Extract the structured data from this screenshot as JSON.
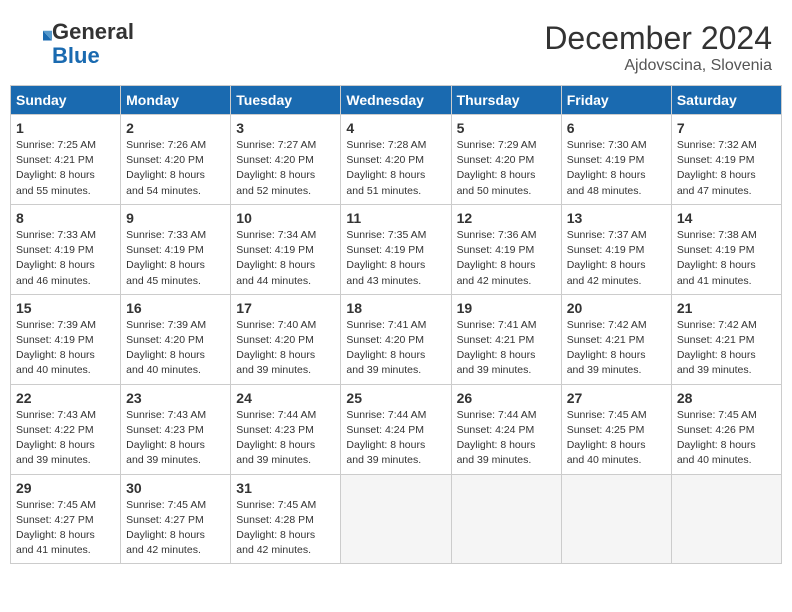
{
  "header": {
    "logo_line1": "General",
    "logo_line2": "Blue",
    "title": "December 2024",
    "subtitle": "Ajdovscina, Slovenia"
  },
  "calendar": {
    "days_of_week": [
      "Sunday",
      "Monday",
      "Tuesday",
      "Wednesday",
      "Thursday",
      "Friday",
      "Saturday"
    ],
    "weeks": [
      [
        {
          "day": "1",
          "sunrise": "7:25 AM",
          "sunset": "4:21 PM",
          "daylight": "8 hours and 55 minutes."
        },
        {
          "day": "2",
          "sunrise": "7:26 AM",
          "sunset": "4:20 PM",
          "daylight": "8 hours and 54 minutes."
        },
        {
          "day": "3",
          "sunrise": "7:27 AM",
          "sunset": "4:20 PM",
          "daylight": "8 hours and 52 minutes."
        },
        {
          "day": "4",
          "sunrise": "7:28 AM",
          "sunset": "4:20 PM",
          "daylight": "8 hours and 51 minutes."
        },
        {
          "day": "5",
          "sunrise": "7:29 AM",
          "sunset": "4:20 PM",
          "daylight": "8 hours and 50 minutes."
        },
        {
          "day": "6",
          "sunrise": "7:30 AM",
          "sunset": "4:19 PM",
          "daylight": "8 hours and 48 minutes."
        },
        {
          "day": "7",
          "sunrise": "7:32 AM",
          "sunset": "4:19 PM",
          "daylight": "8 hours and 47 minutes."
        }
      ],
      [
        {
          "day": "8",
          "sunrise": "7:33 AM",
          "sunset": "4:19 PM",
          "daylight": "8 hours and 46 minutes."
        },
        {
          "day": "9",
          "sunrise": "7:33 AM",
          "sunset": "4:19 PM",
          "daylight": "8 hours and 45 minutes."
        },
        {
          "day": "10",
          "sunrise": "7:34 AM",
          "sunset": "4:19 PM",
          "daylight": "8 hours and 44 minutes."
        },
        {
          "day": "11",
          "sunrise": "7:35 AM",
          "sunset": "4:19 PM",
          "daylight": "8 hours and 43 minutes."
        },
        {
          "day": "12",
          "sunrise": "7:36 AM",
          "sunset": "4:19 PM",
          "daylight": "8 hours and 42 minutes."
        },
        {
          "day": "13",
          "sunrise": "7:37 AM",
          "sunset": "4:19 PM",
          "daylight": "8 hours and 42 minutes."
        },
        {
          "day": "14",
          "sunrise": "7:38 AM",
          "sunset": "4:19 PM",
          "daylight": "8 hours and 41 minutes."
        }
      ],
      [
        {
          "day": "15",
          "sunrise": "7:39 AM",
          "sunset": "4:19 PM",
          "daylight": "8 hours and 40 minutes."
        },
        {
          "day": "16",
          "sunrise": "7:39 AM",
          "sunset": "4:20 PM",
          "daylight": "8 hours and 40 minutes."
        },
        {
          "day": "17",
          "sunrise": "7:40 AM",
          "sunset": "4:20 PM",
          "daylight": "8 hours and 39 minutes."
        },
        {
          "day": "18",
          "sunrise": "7:41 AM",
          "sunset": "4:20 PM",
          "daylight": "8 hours and 39 minutes."
        },
        {
          "day": "19",
          "sunrise": "7:41 AM",
          "sunset": "4:21 PM",
          "daylight": "8 hours and 39 minutes."
        },
        {
          "day": "20",
          "sunrise": "7:42 AM",
          "sunset": "4:21 PM",
          "daylight": "8 hours and 39 minutes."
        },
        {
          "day": "21",
          "sunrise": "7:42 AM",
          "sunset": "4:21 PM",
          "daylight": "8 hours and 39 minutes."
        }
      ],
      [
        {
          "day": "22",
          "sunrise": "7:43 AM",
          "sunset": "4:22 PM",
          "daylight": "8 hours and 39 minutes."
        },
        {
          "day": "23",
          "sunrise": "7:43 AM",
          "sunset": "4:23 PM",
          "daylight": "8 hours and 39 minutes."
        },
        {
          "day": "24",
          "sunrise": "7:44 AM",
          "sunset": "4:23 PM",
          "daylight": "8 hours and 39 minutes."
        },
        {
          "day": "25",
          "sunrise": "7:44 AM",
          "sunset": "4:24 PM",
          "daylight": "8 hours and 39 minutes."
        },
        {
          "day": "26",
          "sunrise": "7:44 AM",
          "sunset": "4:24 PM",
          "daylight": "8 hours and 39 minutes."
        },
        {
          "day": "27",
          "sunrise": "7:45 AM",
          "sunset": "4:25 PM",
          "daylight": "8 hours and 40 minutes."
        },
        {
          "day": "28",
          "sunrise": "7:45 AM",
          "sunset": "4:26 PM",
          "daylight": "8 hours and 40 minutes."
        }
      ],
      [
        {
          "day": "29",
          "sunrise": "7:45 AM",
          "sunset": "4:27 PM",
          "daylight": "8 hours and 41 minutes."
        },
        {
          "day": "30",
          "sunrise": "7:45 AM",
          "sunset": "4:27 PM",
          "daylight": "8 hours and 42 minutes."
        },
        {
          "day": "31",
          "sunrise": "7:45 AM",
          "sunset": "4:28 PM",
          "daylight": "8 hours and 42 minutes."
        },
        null,
        null,
        null,
        null
      ]
    ],
    "labels": {
      "sunrise": "Sunrise: ",
      "sunset": "Sunset: ",
      "daylight": "Daylight: "
    }
  }
}
